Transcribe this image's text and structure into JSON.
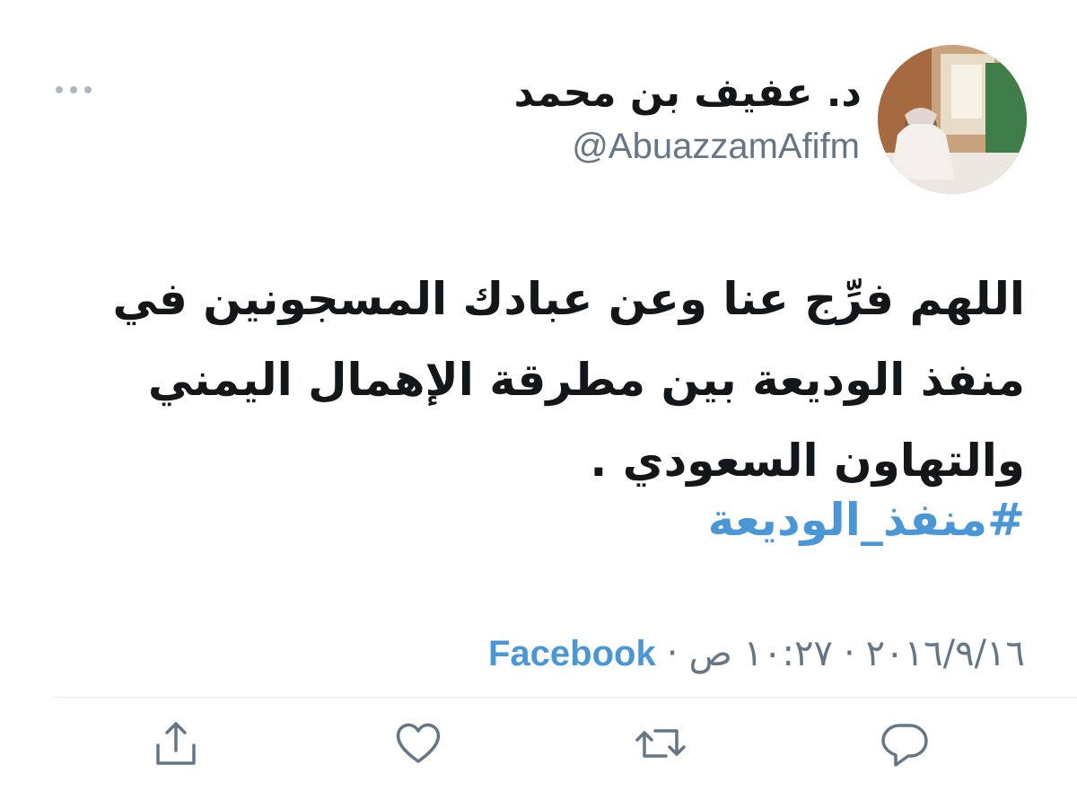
{
  "tweet": {
    "display_name": "د. عفيف بن محمد",
    "handle": "@AbuazzamAfifm",
    "text_lines": [
      "اللهم فرِّج عنا وعن عبادك المسجونين في",
      "منفذ الوديعة بين مطرقة الإهمال اليمني",
      "والتهاون السعودي ."
    ],
    "hashtag": "#منفذ_الوديعة",
    "date": "٢٠١٦/٩/١٦",
    "time": "١٠:٢٧ ص",
    "separator": "·",
    "source": "Facebook"
  },
  "icons": {
    "more": "more-icon",
    "avatar": "avatar-image",
    "share": "share-icon",
    "like": "heart-icon",
    "retweet": "retweet-icon",
    "reply": "reply-icon"
  },
  "colors": {
    "text": "#14171a",
    "secondary": "#657786",
    "link": "#4b97d6",
    "divider": "#e6ecf0"
  }
}
